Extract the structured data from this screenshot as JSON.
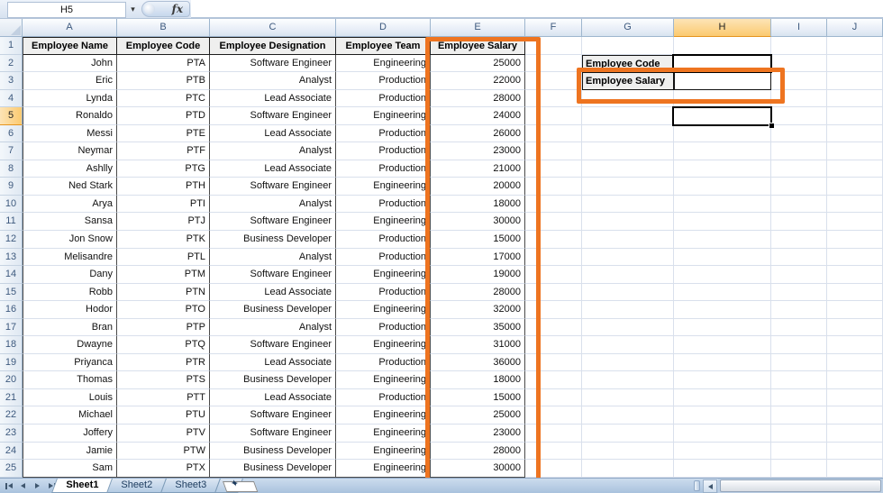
{
  "name_box": {
    "value": "H5"
  },
  "formula_bar": {
    "value": "",
    "fx_label": "fx"
  },
  "grid": {
    "column_letters": [
      "A",
      "B",
      "C",
      "D",
      "E",
      "F",
      "G",
      "H",
      "I",
      "J"
    ],
    "active_column": "H",
    "active_row": 5,
    "active_cell": "H5",
    "header_row": [
      "Employee Name",
      "Employee Code",
      "Employee Designation",
      "Employee Team",
      "Employee Salary"
    ],
    "rows": [
      {
        "row": 2,
        "name": "John",
        "code": "PTA",
        "designation": "Software Engineer",
        "team": "Engineering",
        "salary": "25000"
      },
      {
        "row": 3,
        "name": "Eric",
        "code": "PTB",
        "designation": "Analyst",
        "team": "Production",
        "salary": "22000"
      },
      {
        "row": 4,
        "name": "Lynda",
        "code": "PTC",
        "designation": "Lead Associate",
        "team": "Production",
        "salary": "28000"
      },
      {
        "row": 5,
        "name": "Ronaldo",
        "code": "PTD",
        "designation": "Software Engineer",
        "team": "Engineering",
        "salary": "24000"
      },
      {
        "row": 6,
        "name": "Messi",
        "code": "PTE",
        "designation": "Lead Associate",
        "team": "Production",
        "salary": "26000"
      },
      {
        "row": 7,
        "name": "Neymar",
        "code": "PTF",
        "designation": "Analyst",
        "team": "Production",
        "salary": "23000"
      },
      {
        "row": 8,
        "name": "Ashlly",
        "code": "PTG",
        "designation": "Lead Associate",
        "team": "Production",
        "salary": "21000"
      },
      {
        "row": 9,
        "name": "Ned Stark",
        "code": "PTH",
        "designation": "Software Engineer",
        "team": "Engineering",
        "salary": "20000"
      },
      {
        "row": 10,
        "name": "Arya",
        "code": "PTI",
        "designation": "Analyst",
        "team": "Production",
        "salary": "18000"
      },
      {
        "row": 11,
        "name": "Sansa",
        "code": "PTJ",
        "designation": "Software Engineer",
        "team": "Engineering",
        "salary": "30000"
      },
      {
        "row": 12,
        "name": "Jon Snow",
        "code": "PTK",
        "designation": "Business Developer",
        "team": "Production",
        "salary": "15000"
      },
      {
        "row": 13,
        "name": "Melisandre",
        "code": "PTL",
        "designation": "Analyst",
        "team": "Production",
        "salary": "17000"
      },
      {
        "row": 14,
        "name": "Dany",
        "code": "PTM",
        "designation": "Software Engineer",
        "team": "Engineering",
        "salary": "19000"
      },
      {
        "row": 15,
        "name": "Robb",
        "code": "PTN",
        "designation": "Lead Associate",
        "team": "Production",
        "salary": "28000"
      },
      {
        "row": 16,
        "name": "Hodor",
        "code": "PTO",
        "designation": "Business Developer",
        "team": "Engineering",
        "salary": "32000"
      },
      {
        "row": 17,
        "name": "Bran",
        "code": "PTP",
        "designation": "Analyst",
        "team": "Production",
        "salary": "35000"
      },
      {
        "row": 18,
        "name": "Dwayne",
        "code": "PTQ",
        "designation": "Software Engineer",
        "team": "Engineering",
        "salary": "31000"
      },
      {
        "row": 19,
        "name": "Priyanca",
        "code": "PTR",
        "designation": "Lead Associate",
        "team": "Production",
        "salary": "36000"
      },
      {
        "row": 20,
        "name": "Thomas",
        "code": "PTS",
        "designation": "Business Developer",
        "team": "Engineering",
        "salary": "18000"
      },
      {
        "row": 21,
        "name": "Louis",
        "code": "PTT",
        "designation": "Lead Associate",
        "team": "Production",
        "salary": "15000"
      },
      {
        "row": 22,
        "name": "Michael",
        "code": "PTU",
        "designation": "Software Engineer",
        "team": "Engineering",
        "salary": "25000"
      },
      {
        "row": 23,
        "name": "Joffery",
        "code": "PTV",
        "designation": "Software Engineer",
        "team": "Engineering",
        "salary": "23000"
      },
      {
        "row": 24,
        "name": "Jamie",
        "code": "PTW",
        "designation": "Business Developer",
        "team": "Engineering",
        "salary": "28000"
      },
      {
        "row": 25,
        "name": "Sam",
        "code": "PTX",
        "designation": "Business Developer",
        "team": "Engineering",
        "salary": "30000"
      }
    ]
  },
  "lookup_panel": {
    "code_label": "Employee Code",
    "code_value": "",
    "salary_label": "Employee Salary",
    "salary_value": ""
  },
  "sheet_tabs": {
    "items": [
      "Sheet1",
      "Sheet2",
      "Sheet3"
    ],
    "active": "Sheet1"
  },
  "colors": {
    "annotation_orange": "#ee7420",
    "selected_header_fill": "#fbca70",
    "active_cell_border": "#000000",
    "table_border": "#4a4a4a",
    "gridline": "#d9e0ec"
  }
}
